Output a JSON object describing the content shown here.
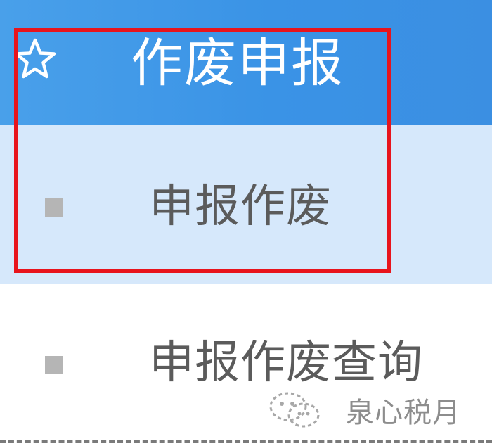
{
  "menu": {
    "header": {
      "icon": "star-outline-icon",
      "title": "作废申报"
    },
    "items": [
      {
        "label": "申报作废",
        "icon": "square-bullet-icon",
        "active": true
      },
      {
        "label": "申报作废查询",
        "icon": "square-bullet-icon",
        "active": false
      }
    ]
  },
  "watermark": {
    "icon": "wechat-logo-icon",
    "text": "泉心税月"
  },
  "colors": {
    "header_bg": "#3b93e6",
    "active_item_bg": "#d6e8fb",
    "highlight_border": "#e8141c",
    "item_text": "#5b5b5b",
    "bullet": "#b5b5b5"
  }
}
